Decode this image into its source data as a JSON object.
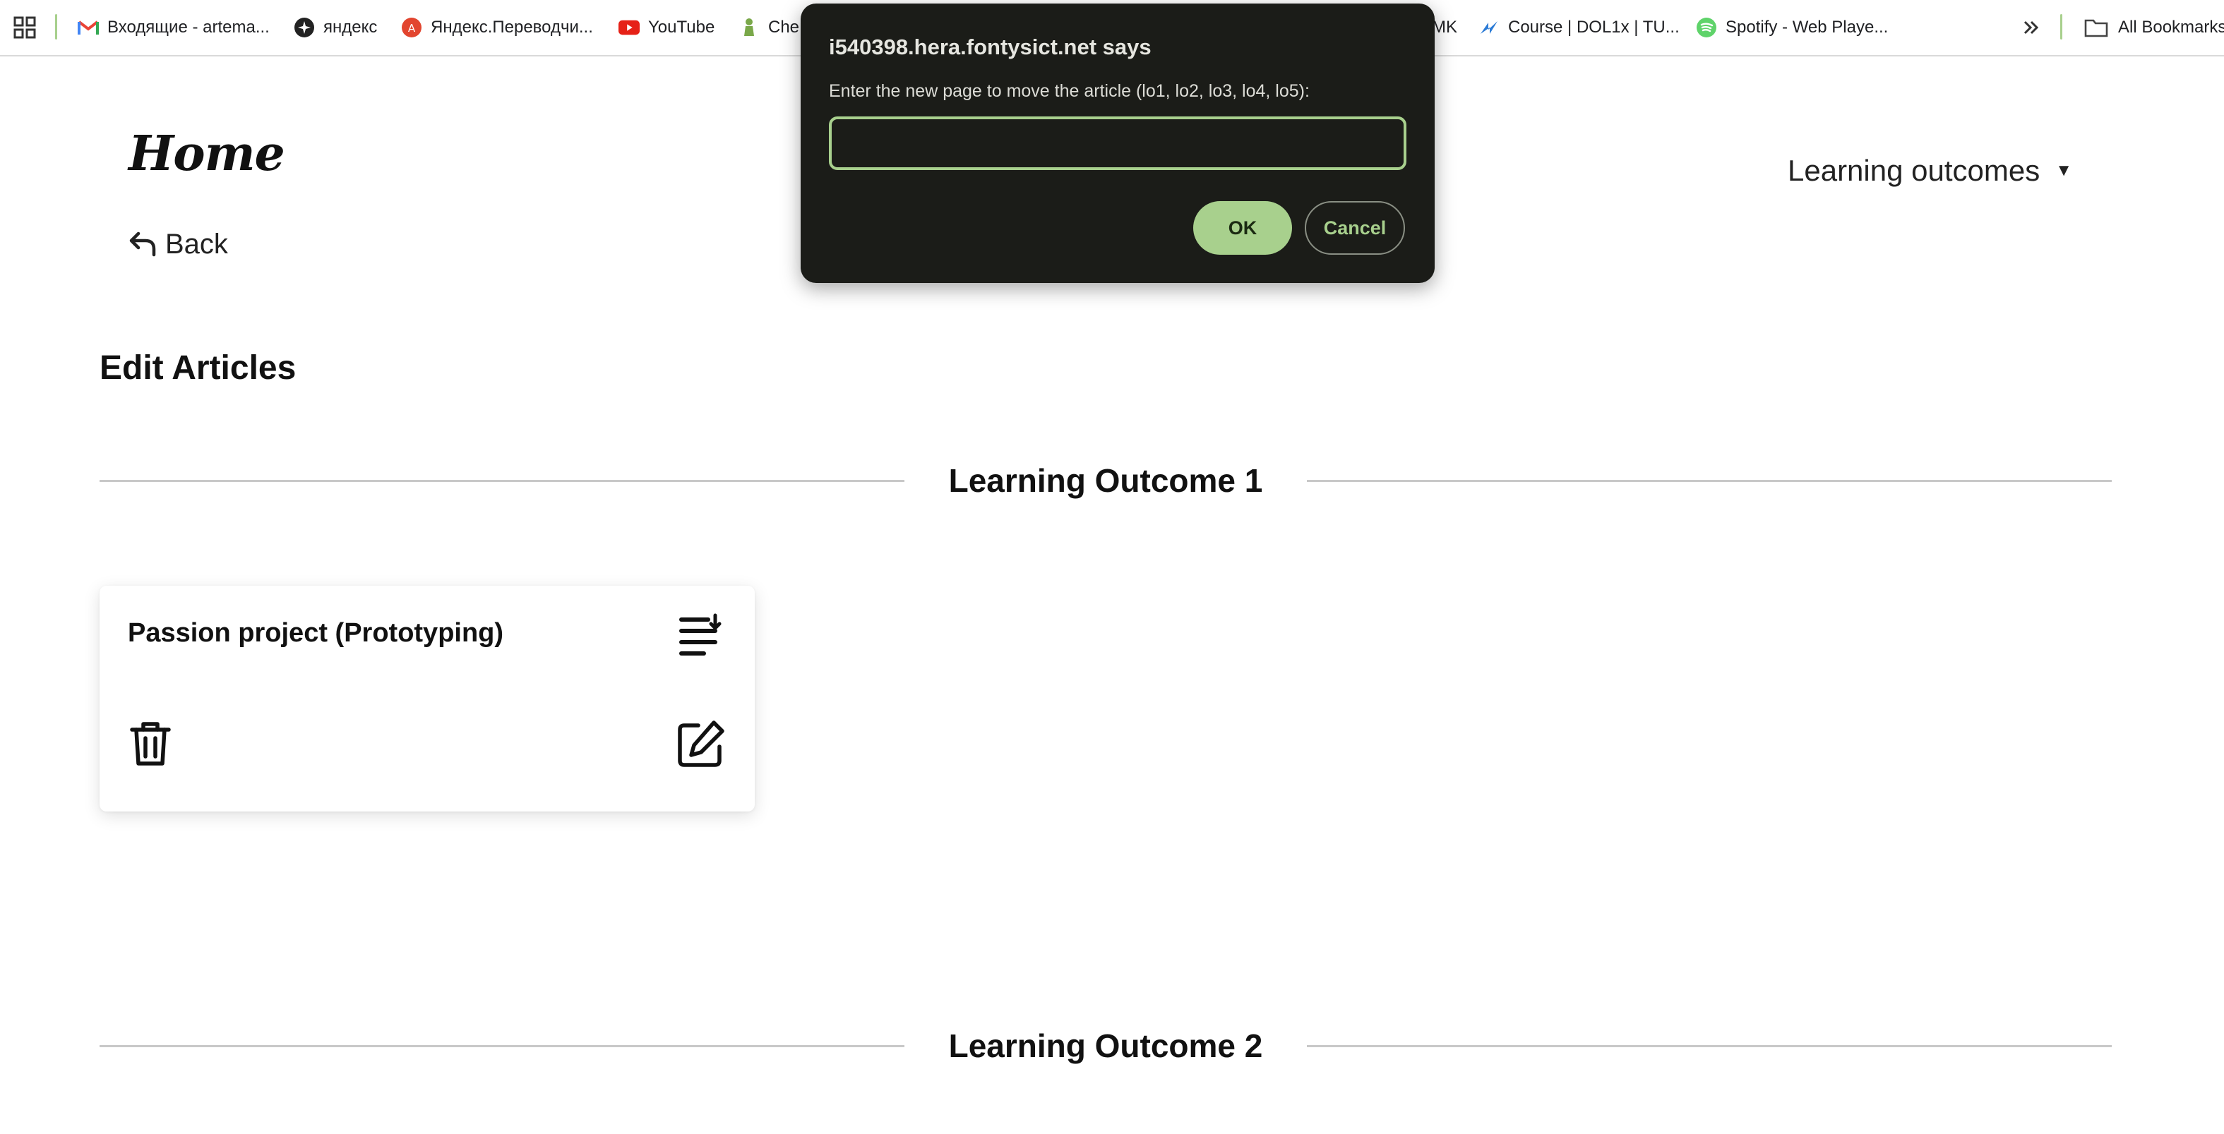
{
  "bookmarks": {
    "items": [
      {
        "label": "Входящие - artema...",
        "icon": "gmail-icon"
      },
      {
        "label": "яндекс",
        "icon": "yandex-icon"
      },
      {
        "label": "Яндекс.Переводчи...",
        "icon": "yandex-translate-icon"
      },
      {
        "label": "YouTube",
        "icon": "youtube-icon"
      },
      {
        "label": "Che",
        "icon": "chess-icon"
      },
      {
        "label": "MK",
        "icon": "hidden-icon"
      },
      {
        "label": "Course | DOL1x | TU...",
        "icon": "edx-icon"
      },
      {
        "label": "Spotify - Web Playe...",
        "icon": "spotify-icon"
      }
    ],
    "all_bookmarks_label": "All Bookmarks"
  },
  "header": {
    "home_label": "Home",
    "back_label": "Back",
    "dropdown_label": "Learning outcomes",
    "dropdown_caret": "▼"
  },
  "main": {
    "page_title": "Edit Articles",
    "sections": [
      {
        "title": "Learning Outcome 1"
      },
      {
        "title": "Learning Outcome 2"
      }
    ],
    "articles": [
      {
        "title": "Passion project (Prototyping)"
      }
    ]
  },
  "dialog": {
    "origin": "i540398.hera.fontysict.net says",
    "message": "Enter the new page to move the article (lo1, lo2, lo3, lo4, lo5):",
    "input_value": "",
    "ok_label": "OK",
    "cancel_label": "Cancel"
  },
  "colors": {
    "accent": "#a8d08d",
    "dialog_bg": "#1b1c18",
    "divider": "#c8c8c8"
  }
}
